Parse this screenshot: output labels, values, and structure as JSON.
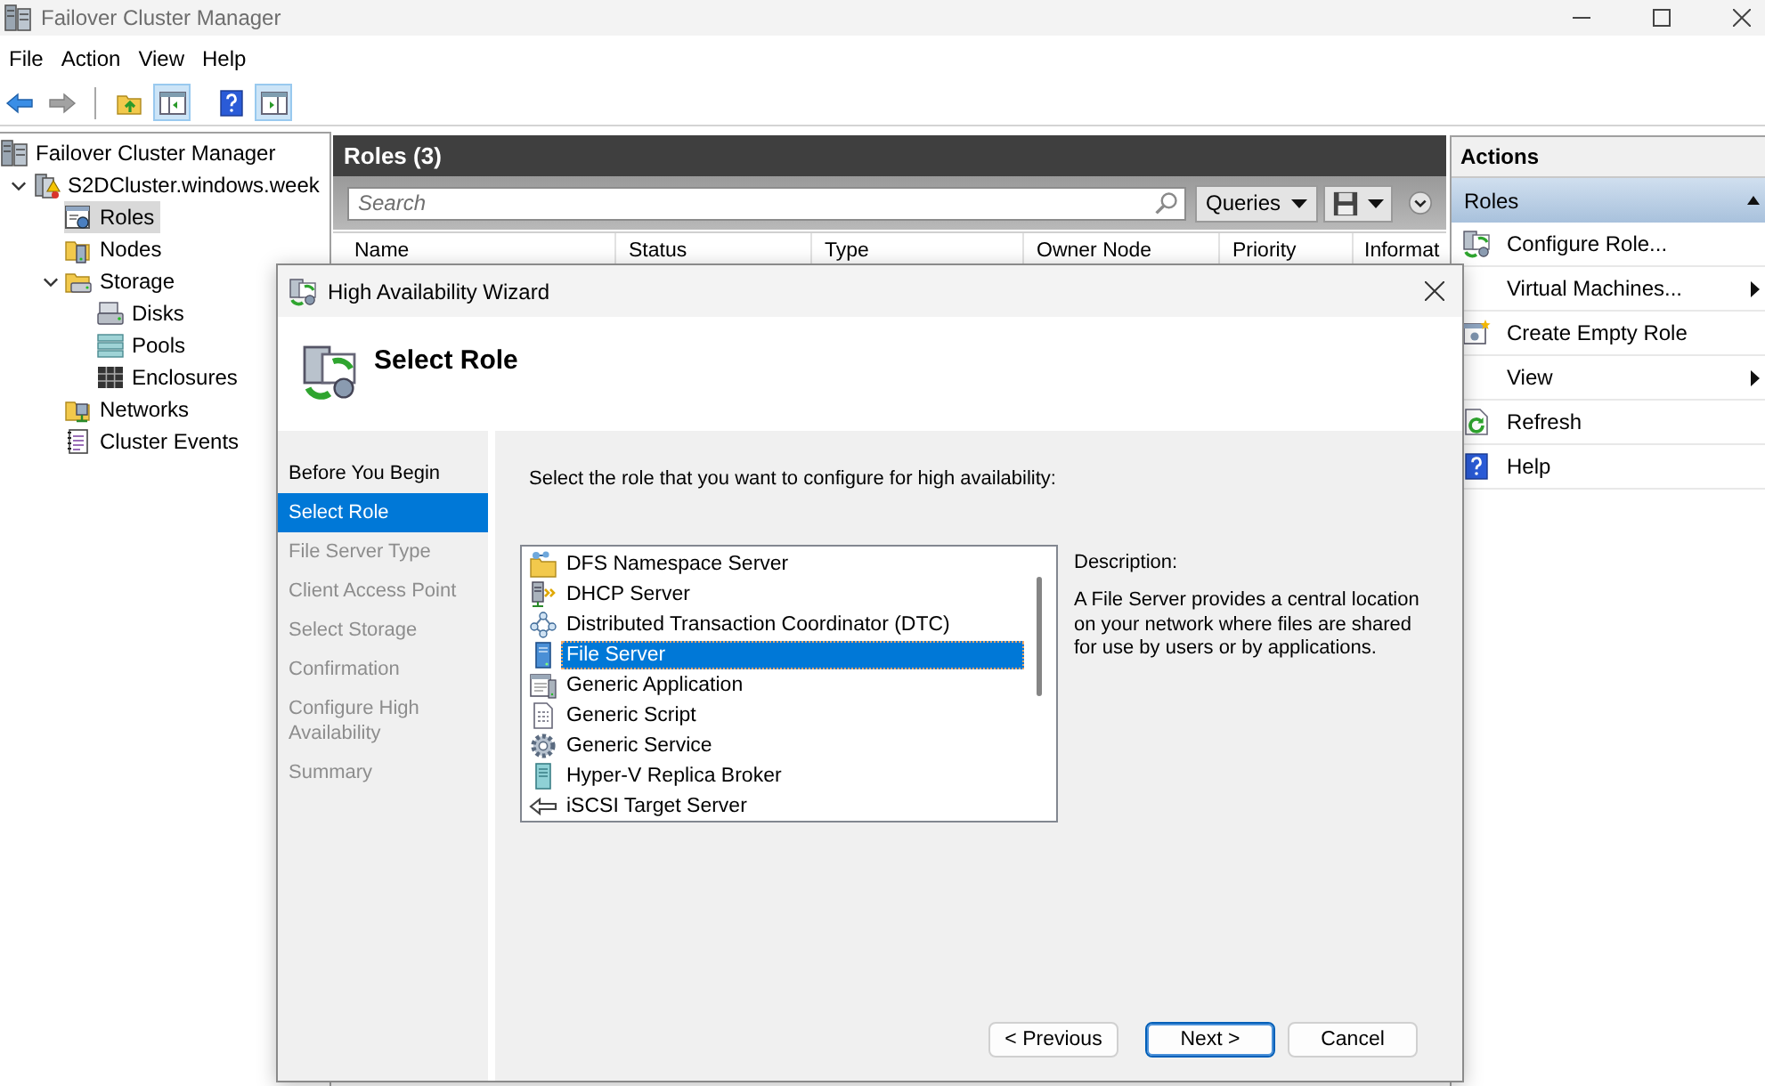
{
  "window": {
    "title": "Failover Cluster Manager"
  },
  "menu": [
    "File",
    "Action",
    "View",
    "Help"
  ],
  "toolbar": [
    {
      "disabled": false,
      "pressed": false
    },
    {
      "disabled": true,
      "pressed": false
    },
    {
      "disabled": false,
      "pressed": false
    },
    {
      "disabled": false,
      "pressed": true
    },
    {
      "disabled": false,
      "pressed": false
    },
    {
      "disabled": false,
      "pressed": true
    }
  ],
  "tree": [
    {
      "label": "Failover Cluster Manager",
      "kind": "manager",
      "selected": false,
      "children": [
        {
          "label": "S2DCluster.windows.week",
          "kind": "cluster",
          "expanded": true,
          "selected": false,
          "children": [
            {
              "label": "Roles",
              "kind": "roles",
              "selected": true
            },
            {
              "label": "Nodes",
              "kind": "nodes",
              "selected": false
            },
            {
              "label": "Storage",
              "kind": "storage",
              "expanded": true,
              "selected": false,
              "children": [
                {
                  "label": "Disks",
                  "kind": "disks",
                  "selected": false
                },
                {
                  "label": "Pools",
                  "kind": "pools",
                  "selected": false
                },
                {
                  "label": "Enclosures",
                  "kind": "enclosures",
                  "selected": false
                }
              ]
            },
            {
              "label": "Networks",
              "kind": "networks",
              "selected": false
            },
            {
              "label": "Cluster Events",
              "kind": "events",
              "selected": false
            }
          ]
        }
      ]
    }
  ],
  "roles_pane": {
    "title": "Roles (3)",
    "search": {
      "placeholder": "Search"
    },
    "queries_button": "Queries",
    "columns": [
      "Name",
      "Status",
      "Type",
      "Owner Node",
      "Priority",
      "Informat"
    ]
  },
  "actions": {
    "title": "Actions",
    "section": {
      "title": "Roles",
      "expanded": true
    },
    "items": [
      {
        "label": "Configure Role...",
        "kind": "configure",
        "submenu": false
      },
      {
        "label": "Virtual Machines...",
        "kind": "plain",
        "submenu": true
      },
      {
        "label": "Create Empty Role",
        "kind": "create",
        "submenu": false
      },
      {
        "label": "View",
        "kind": "plain",
        "submenu": true
      },
      {
        "label": "Refresh",
        "kind": "refresh",
        "submenu": false
      },
      {
        "label": "Help",
        "kind": "help",
        "submenu": false
      }
    ]
  },
  "wizard": {
    "title": "High Availability Wizard",
    "heading": "Select Role",
    "steps": [
      {
        "label": "Before You Begin",
        "selected": false,
        "disabled": false
      },
      {
        "label": "Select Role",
        "selected": true,
        "disabled": false
      },
      {
        "label": "File Server Type",
        "selected": false,
        "disabled": true
      },
      {
        "label": "Client Access Point",
        "selected": false,
        "disabled": true
      },
      {
        "label": "Select Storage",
        "selected": false,
        "disabled": true
      },
      {
        "label": "Confirmation",
        "selected": false,
        "disabled": true
      },
      {
        "label": "Configure High Availability",
        "selected": false,
        "disabled": true
      },
      {
        "label": "Summary",
        "selected": false,
        "disabled": true
      }
    ],
    "instruction": "Select the role that you want to configure for high availability:",
    "roles": [
      {
        "label": "DFS Namespace Server",
        "kind": "dfs",
        "selected": false
      },
      {
        "label": "DHCP Server",
        "kind": "dhcp",
        "selected": false
      },
      {
        "label": "Distributed Transaction Coordinator (DTC)",
        "kind": "dtc",
        "selected": false
      },
      {
        "label": "File Server",
        "kind": "file",
        "selected": true
      },
      {
        "label": "Generic Application",
        "kind": "app",
        "selected": false
      },
      {
        "label": "Generic Script",
        "kind": "script",
        "selected": false
      },
      {
        "label": "Generic Service",
        "kind": "service",
        "selected": false
      },
      {
        "label": "Hyper-V Replica Broker",
        "kind": "replica",
        "selected": false
      },
      {
        "label": "iSCSI Target Server",
        "kind": "iscsi",
        "selected": false
      }
    ],
    "description_label": "Description:",
    "description": "A File Server provides a central location on your network where files are shared for use by users or by applications.",
    "buttons": [
      {
        "label": "< Previous",
        "focused": false
      },
      {
        "label": "Next >",
        "focused": true
      },
      {
        "label": "Cancel",
        "focused": false
      }
    ]
  }
}
